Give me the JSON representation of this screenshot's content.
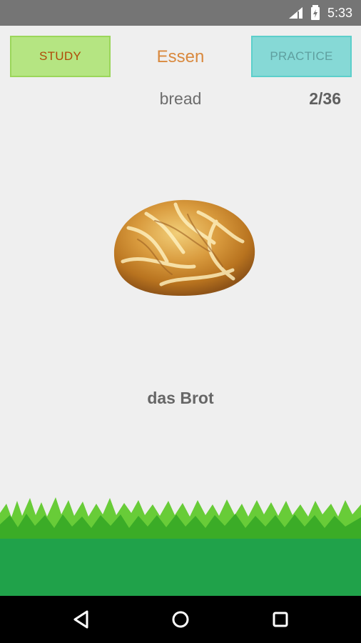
{
  "status_bar": {
    "time": "5:33",
    "icons": [
      "signal-icon",
      "battery-icon"
    ]
  },
  "header": {
    "study_label": "STUDY",
    "topic_title": "Essen",
    "practice_label": "PRACTICE"
  },
  "card": {
    "english_word": "bread",
    "counter": "2/36",
    "image_name": "bread-loaf-image",
    "german_word": "das Brot"
  },
  "navigation": {
    "buttons": [
      "back-icon",
      "home-icon",
      "recents-icon"
    ]
  },
  "colors": {
    "status_bar": "#757575",
    "study_button": "#b5e582",
    "practice_button": "#86d9d6",
    "topic_title": "#d9893e",
    "bottom_green": "#20a24a",
    "navigation_bar": "#000000"
  }
}
